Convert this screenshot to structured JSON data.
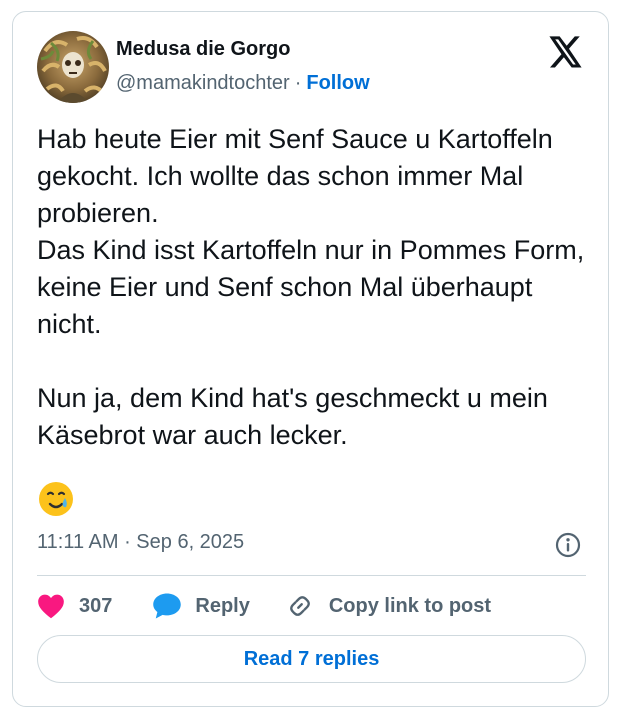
{
  "author": {
    "name": "Medusa die Gorgo",
    "handle": "@mamakindtochter",
    "separator": "·",
    "follow_label": "Follow"
  },
  "tweet": {
    "paragraphs": [
      "Hab heute Eier mit Senf Sauce u Kartoffeln gekocht. Ich wollte das schon immer Mal probieren.",
      "Das Kind isst Kartoffeln nur in Pommes Form, keine Eier und Senf schon Mal überhaupt nicht.",
      "Nun ja, dem Kind hat's geschmeckt u mein Käsebrot war auch lecker."
    ],
    "emoji": "smiling-face-with-tear",
    "timestamp": "11:11 AM · Sep 6, 2025"
  },
  "actions": {
    "like_count": "307",
    "reply_label": "Reply",
    "copy_label": "Copy link to post"
  },
  "read_replies_label": "Read 7 replies",
  "icons": {
    "logo": "x-logo-icon",
    "like": "heart-icon",
    "reply": "speech-bubble-icon",
    "copy": "link-icon",
    "info": "info-icon"
  },
  "colors": {
    "link_blue": "#006fd6",
    "heart_pink": "#f91880",
    "reply_blue": "#1d9bf0",
    "muted_gray": "#536471",
    "border": "#cfd9de"
  }
}
